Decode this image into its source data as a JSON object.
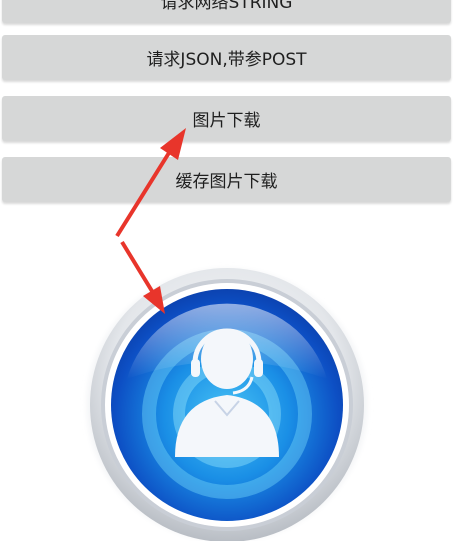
{
  "buttons": [
    {
      "label": "请求网络STRING"
    },
    {
      "label": "请求JSON,带参POST"
    },
    {
      "label": "图片下载"
    },
    {
      "label": "缓存图片下载"
    }
  ],
  "image": {
    "icon": "customer-service-avatar-icon"
  },
  "colors": {
    "button_bg": "#d6d7d7",
    "arrow": "#e8352b",
    "icon_blue": "#1565d8"
  }
}
